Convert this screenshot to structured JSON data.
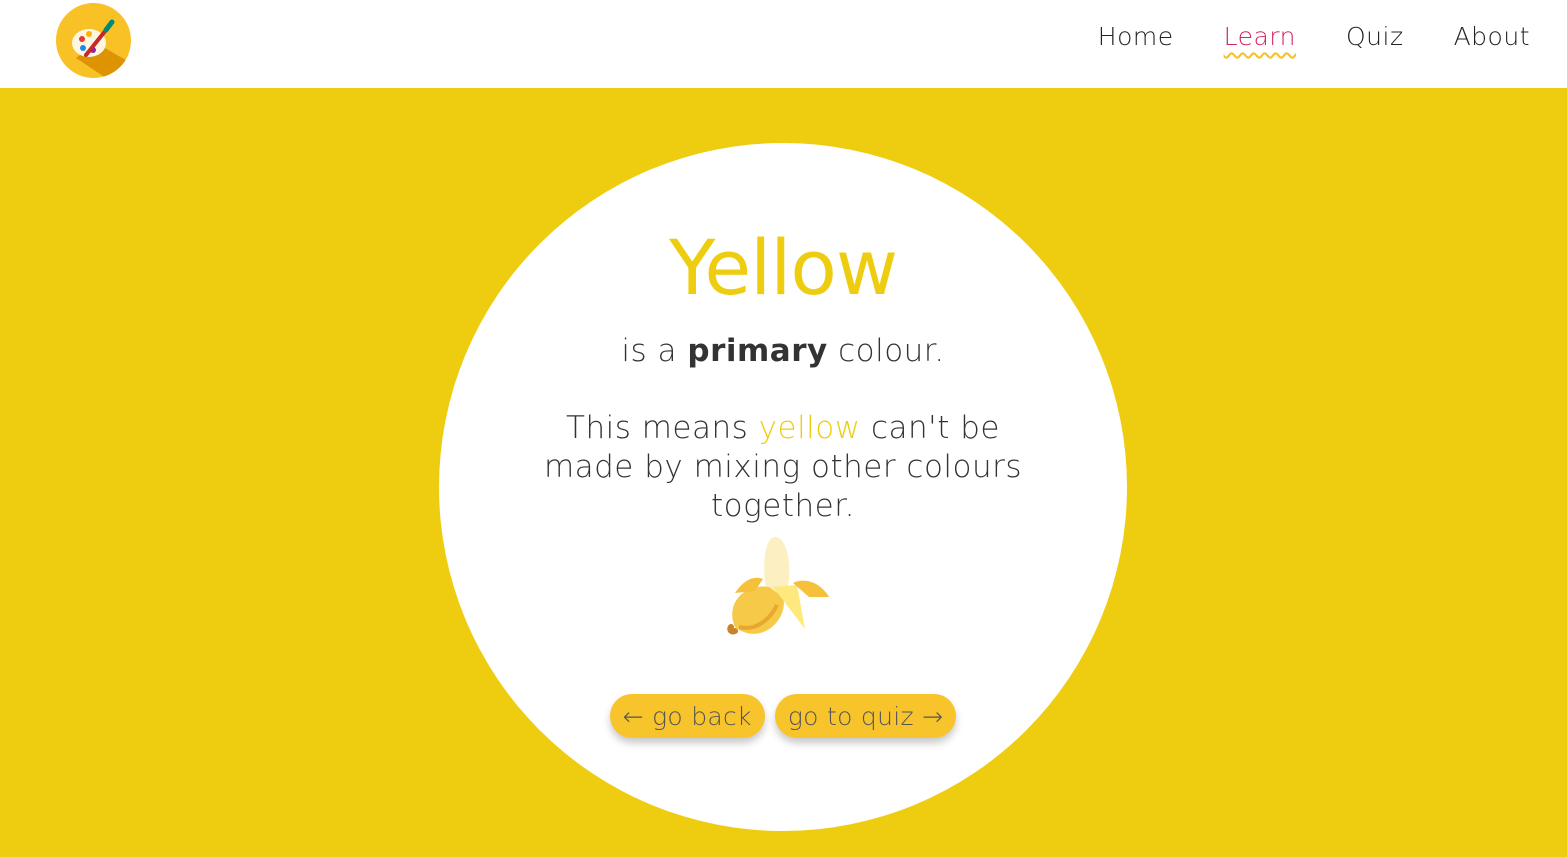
{
  "nav": {
    "logo_icon": "paint-palette-icon",
    "links": [
      {
        "label": "Home"
      },
      {
        "label": "Learn",
        "active": true
      },
      {
        "label": "Quiz"
      },
      {
        "label": "About"
      }
    ]
  },
  "lesson": {
    "title": "Yellow",
    "subtitle_prefix": "is a ",
    "subtitle_emphasis": "primary",
    "subtitle_suffix": " colour.",
    "desc_prefix": "This means ",
    "desc_highlight": "yellow",
    "desc_suffix": " can't be made by mixing other colours together.",
    "illustration_icon": "banana-icon"
  },
  "buttons": {
    "back_label": "← go back",
    "quiz_label": "go to quiz →"
  },
  "colors": {
    "background": "#EECD10",
    "accent": "#F8C42C",
    "active_link": "#D42561",
    "underline": "#F5C021"
  }
}
